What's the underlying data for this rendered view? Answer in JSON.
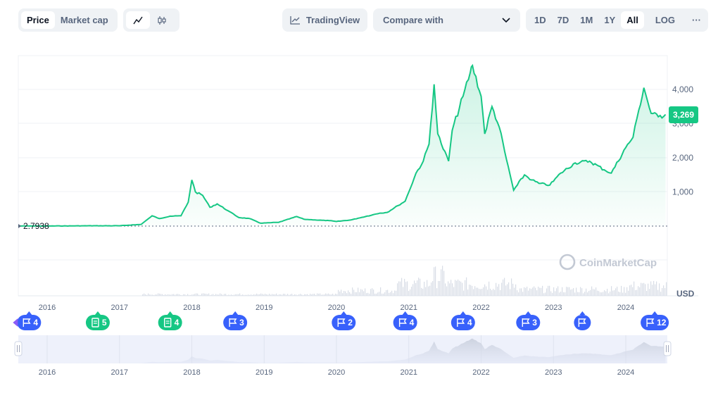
{
  "toolbar": {
    "type_tabs": [
      "Price",
      "Market cap"
    ],
    "chart_modes": [
      "line-chart-icon",
      "candlestick-icon"
    ],
    "tradingview_label": "TradingView",
    "compare_label": "Compare with",
    "ranges": [
      "1D",
      "7D",
      "1M",
      "1Y",
      "All"
    ],
    "active_range": "All",
    "log_label": "LOG",
    "more_label": "···"
  },
  "chart_data": {
    "type": "area",
    "currency_label": "USD",
    "y_ticks": [
      1000,
      2000,
      3000,
      4000
    ],
    "y_tick_labels": [
      "1,000",
      "2,000",
      "3,000",
      "4,000"
    ],
    "ylim": [
      0,
      5000
    ],
    "current_price_label": "3,269",
    "start_price_label": "2.7938",
    "x_tick_labels": [
      "2016",
      "2017",
      "2018",
      "2019",
      "2020",
      "2021",
      "2022",
      "2023",
      "2024"
    ],
    "watermark": "CoinMarketCap",
    "colors": {
      "line": "#16c784",
      "fill_top": "#16c784",
      "label_bg": "#16c784",
      "flag_blue": "#3861fb",
      "flag_green": "#16c784"
    },
    "series": [
      {
        "x": [
          2015.6,
          2016.0,
          2016.5,
          2017.0,
          2017.3,
          2017.45,
          2017.55,
          2017.7,
          2017.85,
          2017.95,
          2018.0,
          2018.05,
          2018.15,
          2018.25,
          2018.35,
          2018.5,
          2018.65,
          2018.8,
          2018.95,
          2019.2,
          2019.45,
          2019.55,
          2019.7,
          2019.9,
          2020.0,
          2020.2,
          2020.3,
          2020.5,
          2020.6,
          2020.7,
          2020.85,
          2020.95,
          2021.0,
          2021.1,
          2021.2,
          2021.28,
          2021.35,
          2021.4,
          2021.45,
          2021.55,
          2021.6,
          2021.75,
          2021.85,
          2021.88,
          2022.0,
          2022.05,
          2022.15,
          2022.25,
          2022.35,
          2022.45,
          2022.5,
          2022.6,
          2022.7,
          2022.8,
          2022.95,
          2023.1,
          2023.3,
          2023.5,
          2023.7,
          2023.8,
          2024.0,
          2024.1,
          2024.18,
          2024.25,
          2024.35,
          2024.45,
          2024.55
        ],
        "values": [
          2.8,
          2.5,
          8,
          9,
          50,
          300,
          220,
          290,
          300,
          700,
          1350,
          1000,
          900,
          550,
          650,
          450,
          250,
          220,
          85,
          110,
          280,
          200,
          180,
          160,
          135,
          180,
          230,
          330,
          380,
          400,
          600,
          730,
          1000,
          1550,
          1900,
          2400,
          4150,
          2700,
          2400,
          1900,
          2800,
          3800,
          4500,
          4700,
          3800,
          2700,
          3500,
          2900,
          1950,
          1050,
          1200,
          1500,
          1350,
          1250,
          1200,
          1550,
          1850,
          1900,
          1650,
          1550,
          2300,
          2600,
          3400,
          4050,
          3300,
          3200,
          3269
        ]
      }
    ],
    "events": [
      {
        "kind": "flag",
        "count": "4",
        "year": 2015.75,
        "color": "#3861fb"
      },
      {
        "kind": "doc",
        "count": "5",
        "year": 2016.7,
        "color": "#16c784"
      },
      {
        "kind": "doc",
        "count": "4",
        "year": 2017.7,
        "color": "#16c784"
      },
      {
        "kind": "flag",
        "count": "3",
        "year": 2018.6,
        "color": "#3861fb"
      },
      {
        "kind": "flag",
        "count": "2",
        "year": 2020.1,
        "color": "#3861fb"
      },
      {
        "kind": "flag",
        "count": "4",
        "year": 2020.95,
        "color": "#3861fb"
      },
      {
        "kind": "flag",
        "count": "4",
        "year": 2021.75,
        "color": "#3861fb"
      },
      {
        "kind": "flag",
        "count": "3",
        "year": 2022.65,
        "color": "#3861fb"
      },
      {
        "kind": "flag",
        "count": "",
        "year": 2023.4,
        "color": "#3861fb"
      },
      {
        "kind": "flag",
        "count": "12",
        "year": 2024.4,
        "color": "#3861fb"
      }
    ]
  }
}
